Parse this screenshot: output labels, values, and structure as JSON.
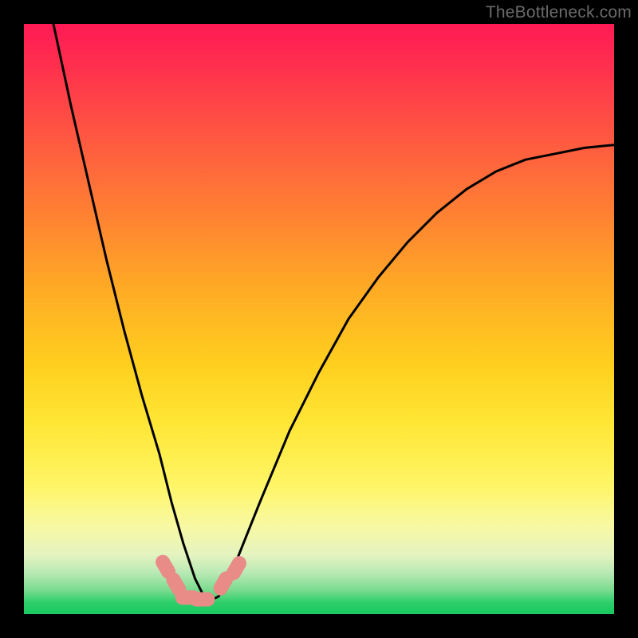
{
  "watermark": "TheBottleneck.com",
  "chart_data": {
    "type": "line",
    "title": "",
    "xlabel": "",
    "ylabel": "",
    "xlim": [
      0,
      100
    ],
    "ylim": [
      0,
      100
    ],
    "grid": false,
    "legend": false,
    "background_gradient": {
      "direction": "vertical",
      "stops": [
        {
          "pos": 0.0,
          "color": "#ff1a55"
        },
        {
          "pos": 0.25,
          "color": "#ff6a3b"
        },
        {
          "pos": 0.5,
          "color": "#ffc01e"
        },
        {
          "pos": 0.78,
          "color": "#fff565"
        },
        {
          "pos": 0.93,
          "color": "#b9e9b4"
        },
        {
          "pos": 1.0,
          "color": "#18c95f"
        }
      ]
    },
    "series": [
      {
        "name": "bottleneck-curve",
        "color": "#000000",
        "x": [
          5,
          8,
          11,
          14,
          17,
          20,
          23,
          25,
          27,
          29,
          31,
          33,
          36,
          40,
          45,
          50,
          55,
          60,
          65,
          70,
          75,
          80,
          85,
          90,
          95,
          100
        ],
        "values": [
          100,
          86,
          73,
          60,
          48,
          37,
          27,
          19,
          12,
          6,
          2,
          3,
          9,
          19,
          31,
          41,
          50,
          57,
          63,
          68,
          72,
          75,
          77,
          78,
          79,
          79.5
        ]
      }
    ],
    "markers": [
      {
        "name": "point-a",
        "x": 24.0,
        "y": 8.0,
        "color": "#e98b87"
      },
      {
        "name": "point-b",
        "x": 25.8,
        "y": 5.0,
        "color": "#e98b87"
      },
      {
        "name": "point-c",
        "x": 27.8,
        "y": 2.8,
        "color": "#e98b87"
      },
      {
        "name": "point-d",
        "x": 30.2,
        "y": 2.5,
        "color": "#e98b87"
      },
      {
        "name": "point-e",
        "x": 33.8,
        "y": 5.2,
        "color": "#e98b87"
      },
      {
        "name": "point-f",
        "x": 36.0,
        "y": 7.8,
        "color": "#e98b87"
      }
    ]
  }
}
